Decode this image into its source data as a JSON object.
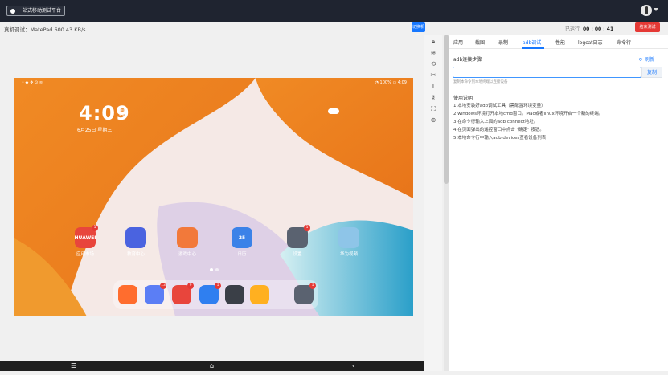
{
  "topbar": {
    "brand": "一站式移动测试平台"
  },
  "subbar": {
    "device_info": "真机调试：MatePad  600.43 KB/s",
    "switch_button": "切换机型",
    "runtime_label": "已运行",
    "runtime_value": "00 : 00 : 41",
    "end_button": "结束测试"
  },
  "tablet": {
    "status_left": "• ◆ ❖ ⊙ ≋",
    "status_right": "◔ 100% ▭ 4:09",
    "clock": "4:09",
    "clock_sub_1": "PM",
    "clock_sub_2": "4:09",
    "date": "6月25日 星期三",
    "apps": [
      {
        "label": "应用市场",
        "icon": "appgallery-icon",
        "icon_text": "HUAWEI",
        "badge": "1",
        "color": "#e8453c"
      },
      {
        "label": "教育中心",
        "icon": "education-center-icon",
        "icon_text": "",
        "badge": "",
        "color": "#4a63e0"
      },
      {
        "label": "游戏中心",
        "icon": "game-center-icon",
        "icon_text": "",
        "badge": "",
        "color": "#f2793a"
      },
      {
        "label": "日历",
        "icon": "calendar-icon",
        "icon_text": "25",
        "badge": "",
        "color": "#3b82e8"
      },
      {
        "label": "设置",
        "icon": "settings-icon",
        "icon_text": "",
        "badge": "1",
        "color": "#5a6270"
      },
      {
        "label": "华为视频",
        "icon": "huawei-video-icon",
        "icon_text": "",
        "badge": "",
        "color": "#8ec5e8"
      }
    ],
    "dock": [
      {
        "icon": "video-player-icon",
        "badge": "",
        "color": "#ff6d2e"
      },
      {
        "icon": "music-icon",
        "badge": "13",
        "color": "#5b7ef5"
      },
      {
        "icon": "books-icon",
        "badge": "9",
        "color": "#e8453c"
      },
      {
        "icon": "browser-icon",
        "badge": "1",
        "color": "#2f7ff0"
      },
      {
        "icon": "camera-icon",
        "badge": "",
        "color": "#3a3f47"
      },
      {
        "icon": "gallery-icon",
        "badge": "",
        "color": "#ffb020"
      },
      {
        "icon": "settings-dock-icon",
        "badge": "1",
        "color": "#5a6270"
      }
    ]
  },
  "navbar": {
    "menu": "☰",
    "home": "⌂",
    "back": "‹"
  },
  "toolbar": {
    "tools": [
      "lock-icon",
      "wifi-icon",
      "rotate-icon",
      "cut-icon",
      "text-input-icon",
      "key-icon",
      "fullscreen-icon",
      "install-app-icon"
    ]
  },
  "panel": {
    "tabs": [
      "应用",
      "截图",
      "录制",
      "adb调试",
      "性能",
      "logcat日志",
      "命令行"
    ],
    "active_tab": "adb调试",
    "section_title": "adb连接步骤",
    "refresh": "⟳ 刷新",
    "input_value": "",
    "copy_button": "复制",
    "hint": "复制本命令到本地终端以连接设备",
    "usage_title": "使用说明",
    "steps": [
      "1.本地安装好adb调试工具（需配置环境变量）",
      "2.windows环境打开本地cmd窗口。Mac或者linux环境开启一个新的终端。",
      "3.在命令行输入上面的adb connect地址。",
      "4.在页面弹出的遥控窗口中点击 \"确定\" 按钮。",
      "5.本地命令行中输入adb devices查看设备列表"
    ]
  }
}
